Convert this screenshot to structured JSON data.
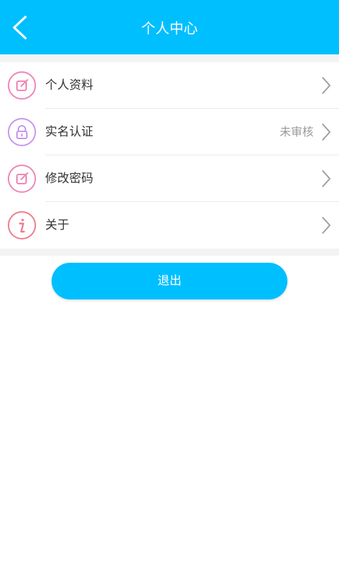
{
  "header": {
    "title": "个人中心",
    "back_icon": "chevron-left-icon",
    "background": "#00BFFF"
  },
  "menu": {
    "items": [
      {
        "label": "个人资料",
        "icon": "edit-icon",
        "value": ""
      },
      {
        "label": "实名认证",
        "icon": "lock-icon",
        "value": "未审核"
      },
      {
        "label": "修改密码",
        "icon": "edit-icon",
        "value": ""
      },
      {
        "label": "关于",
        "icon": "info-icon",
        "value": ""
      }
    ]
  },
  "logout": {
    "label": "退出",
    "color": "#00BFFF"
  },
  "colors": {
    "accent": "#00BFFF",
    "icon_pink": "#ef86b7",
    "icon_purple": "#c995f0",
    "icon_red": "#f07c8c",
    "separator": "#f3f3f3"
  }
}
